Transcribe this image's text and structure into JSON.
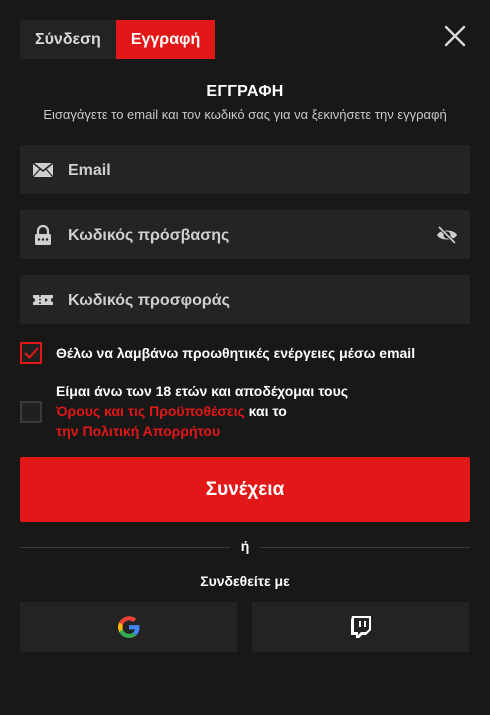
{
  "tabs": {
    "login": "Σύνδεση",
    "signup": "Εγγραφή"
  },
  "form": {
    "title": "ΕΓΓΡΑΦΗ",
    "subtitle": "Εισαγάγετε το email και τον κωδικό σας για να ξεκινήσετε την εγγραφή",
    "email_placeholder": "Email",
    "password_placeholder": "Κωδικός πρόσβασης",
    "promo_placeholder": "Κωδικός προσφοράς"
  },
  "checks": {
    "promo_emails": {
      "label": "Θέλω να λαμβάνω προωθητικές ενέργειες μέσω email",
      "checked": true
    },
    "age_terms": {
      "line1": "Είμαι άνω των 18 ετών και αποδέχομαι τους",
      "terms_link": "Όρους και τις Προϋποθέσεις",
      "and": " και το",
      "privacy_link": "την Πολιτική Απορρήτου",
      "checked": false
    }
  },
  "submit_label": "Συνέχεια",
  "divider_or": "ή",
  "social_heading": "Συνδεθείτε με",
  "social": {
    "google": "google-icon",
    "twitch": "twitch-icon"
  },
  "colors": {
    "accent": "#e21717",
    "background": "#181818",
    "field": "#242424"
  }
}
